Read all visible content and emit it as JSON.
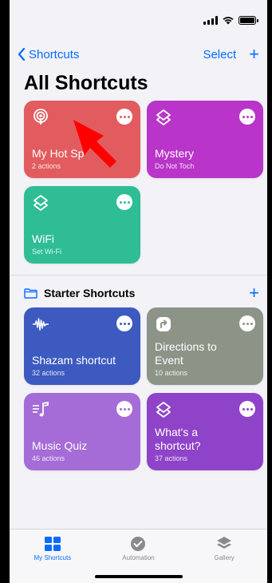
{
  "nav": {
    "back_label": "Shortcuts",
    "select_label": "Select",
    "add_label": "+"
  },
  "page_title": "All Shortcuts",
  "my_shortcuts": [
    {
      "name": "My Hot Sp",
      "sub": "2 actions",
      "color": "#e25c5f",
      "icon": "podcast-icon",
      "dot_color": "#e25c5f"
    },
    {
      "name": "Mystery",
      "sub": "Do Not Toch",
      "color": "#b934c9",
      "icon": "layers-icon",
      "dot_color": "#b934c9"
    },
    {
      "name": "WiFi",
      "sub": "Set Wi-Fi",
      "color": "#2fbd95",
      "icon": "layers-icon",
      "dot_color": "#2fbd95"
    }
  ],
  "section": {
    "title": "Starter Shortcuts",
    "add_label": "+"
  },
  "starter_shortcuts": [
    {
      "name": "Shazam shortcut",
      "sub": "32 actions",
      "color": "#3d5ac0",
      "icon": "waveform-icon"
    },
    {
      "name": "Directions to Event",
      "name_l1": "Directions to",
      "name_l2": "Event",
      "sub": "10 actions",
      "color": "#8c9488",
      "icon": "direction-icon"
    },
    {
      "name": "Music Quiz",
      "sub": "46 actions",
      "color": "#a56bd6",
      "icon": "music-list-icon"
    },
    {
      "name": "What's a shortcut?",
      "name_l1": "What's a",
      "name_l2": "shortcut?",
      "sub": "37 actions",
      "color": "#8e43c8",
      "icon": "layers-icon"
    }
  ],
  "tabs": [
    {
      "label": "My Shortcuts",
      "icon": "grid-icon",
      "active": true
    },
    {
      "label": "Automation",
      "icon": "check-circle-icon",
      "active": false
    },
    {
      "label": "Gallery",
      "icon": "stack-icon",
      "active": false
    }
  ],
  "colors": {
    "accent": "#0a6cff",
    "arrow": "#ff0000"
  }
}
